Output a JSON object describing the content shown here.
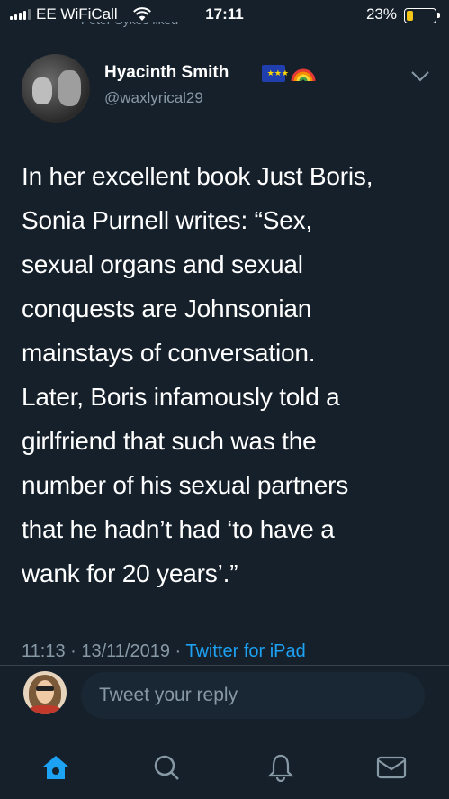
{
  "status_bar": {
    "carrier": "EE WiFiCall",
    "time": "17:11",
    "battery": "23%",
    "battery_level": 0.23
  },
  "context": {
    "liked_by": "Peter Sykes liked"
  },
  "tweet": {
    "author_name": "Hyacinth Smith",
    "author_handle": "@waxlyrical29",
    "flag_label": "EU",
    "icons": [
      "eu-flag-icon",
      "rainbow-icon",
      "chevron-down-icon"
    ],
    "lines": [
      "In her excellent book Just Boris,",
      "Sonia Purnell writes: “Sex,",
      "sexual organs and sexual",
      "conquests are Johnsonian",
      "mainstays of conversation.",
      "Later, Boris infamously told a",
      "girlfriend that such was the",
      "number of his sexual partners",
      "that he hadn’t had ‘to have a",
      "wank for 20 years’.”"
    ],
    "timestamp": "11:13 · 13/11/2019 · ",
    "client": "Twitter for iPad"
  },
  "reply": {
    "placeholder": "Tweet your reply"
  },
  "tab_bar": {
    "icons": [
      "home-icon",
      "search-icon",
      "notifications-icon",
      "messages-icon"
    ],
    "accent": "#1da1f2",
    "inactive": "#8899a6"
  },
  "colors": {
    "background": "#15202b",
    "secondary_text": "#8899a6",
    "link": "#1da1f2"
  }
}
